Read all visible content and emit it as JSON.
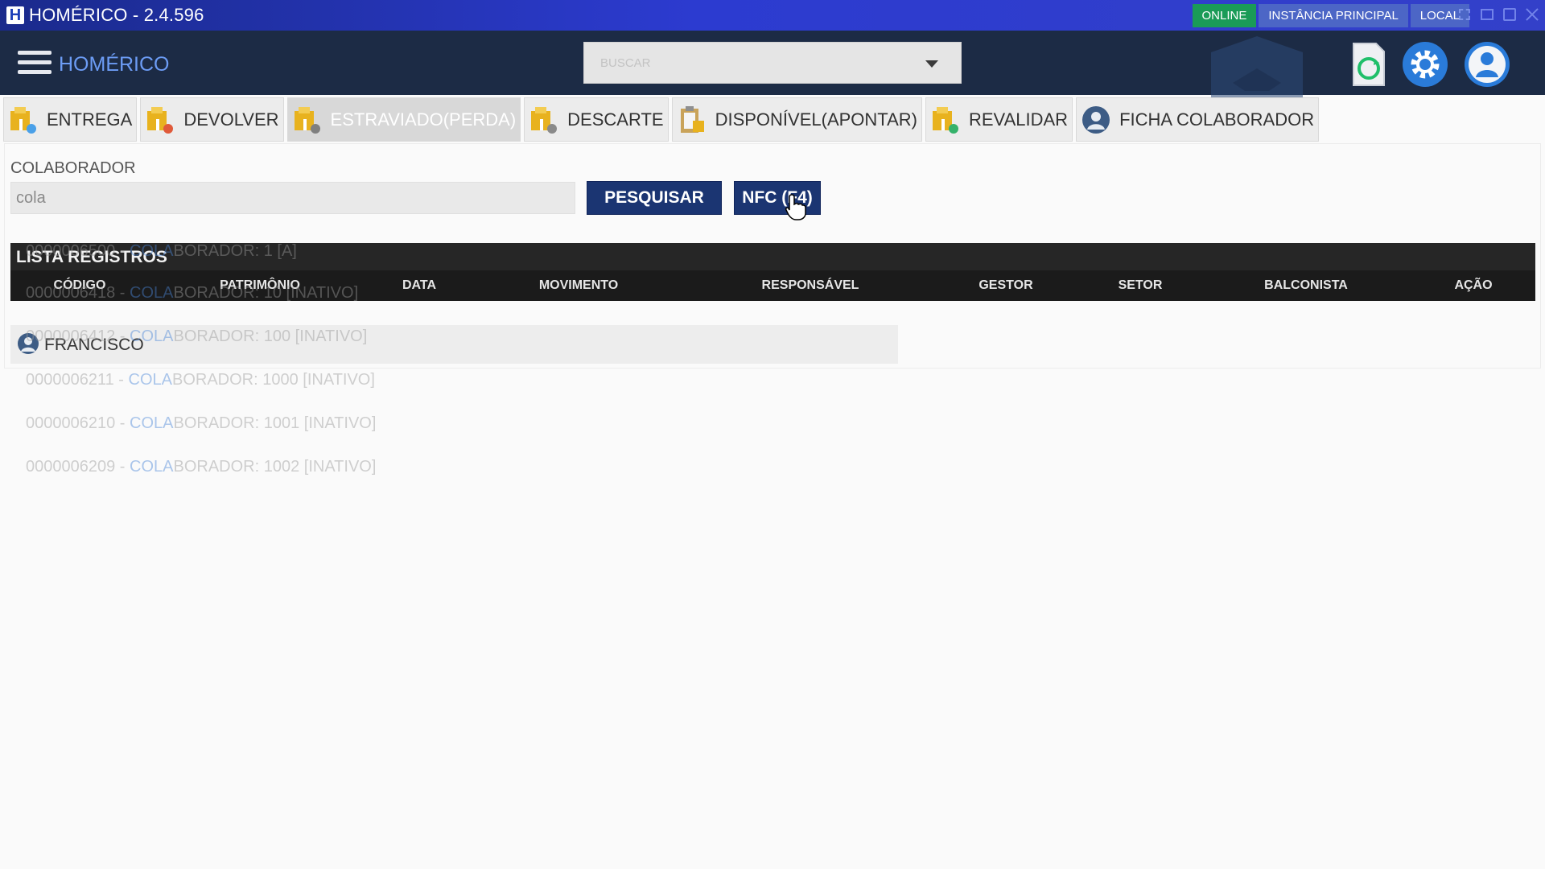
{
  "window": {
    "title": "HOMÉRICO - 2.4.596",
    "logo_letter": "H",
    "status": {
      "online": "ONLINE",
      "instance": "INSTÂNCIA PRINCIPAL",
      "local": "LOCAL"
    }
  },
  "header": {
    "brand": "HOMÉRICO",
    "search_placeholder": "BUSCAR"
  },
  "tabs": [
    {
      "label": "ENTREGA",
      "icon": "box-icon",
      "active": false
    },
    {
      "label": "DEVOLVER",
      "icon": "box-icon",
      "active": false
    },
    {
      "label": "ESTRAVIADO(PERDA)",
      "icon": "box-icon",
      "active": true
    },
    {
      "label": "DESCARTE",
      "icon": "box-icon",
      "active": false
    },
    {
      "label": "DISPONÍVEL(APONTAR)",
      "icon": "clipboard-icon",
      "active": false
    },
    {
      "label": "REVALIDAR",
      "icon": "box-icon",
      "active": false
    },
    {
      "label": "FICHA COLABORADOR",
      "icon": "user-icon",
      "active": false
    }
  ],
  "form": {
    "label": "COLABORADOR",
    "value": "cola",
    "search_button": "PESQUISAR",
    "nfc_button": "NFC (F4)"
  },
  "list": {
    "title": "LISTA REGISTROS",
    "columns": [
      "CÓDIGO",
      "PATRIMÔNIO",
      "DATA",
      "MOVIMENTO",
      "RESPONSÁVEL",
      "GESTOR",
      "SETOR",
      "BALCONISTA",
      "AÇÃO"
    ],
    "rows": [
      {
        "label": "FRANCISCO"
      }
    ]
  },
  "autocomplete_ghost": [
    {
      "code": "0000006500 - ",
      "match": "COLA",
      "rest": "BORADOR: 1 [A]"
    },
    {
      "code": "0000006418 - ",
      "match": "COLA",
      "rest": "BORADOR: 10 [INATIVO]"
    },
    {
      "code": "0000006412 - ",
      "match": "COLA",
      "rest": "BORADOR: 100 [INATIVO]"
    },
    {
      "code": "0000006211 - ",
      "match": "COLA",
      "rest": "BORADOR: 1000 [INATIVO]"
    },
    {
      "code": "0000006210 - ",
      "match": "COLA",
      "rest": "BORADOR: 1001 [INATIVO]"
    },
    {
      "code": "0000006209 - ",
      "match": "COLA",
      "rest": "BORADOR: 1002 [INATIVO]"
    }
  ],
  "colors": {
    "titlebar": "#2c3bd0",
    "header": "#1c2b45",
    "brand": "#6c9cf5",
    "online": "#1a9b57",
    "button": "#1b3572",
    "table_header": "#1b1b1b"
  }
}
